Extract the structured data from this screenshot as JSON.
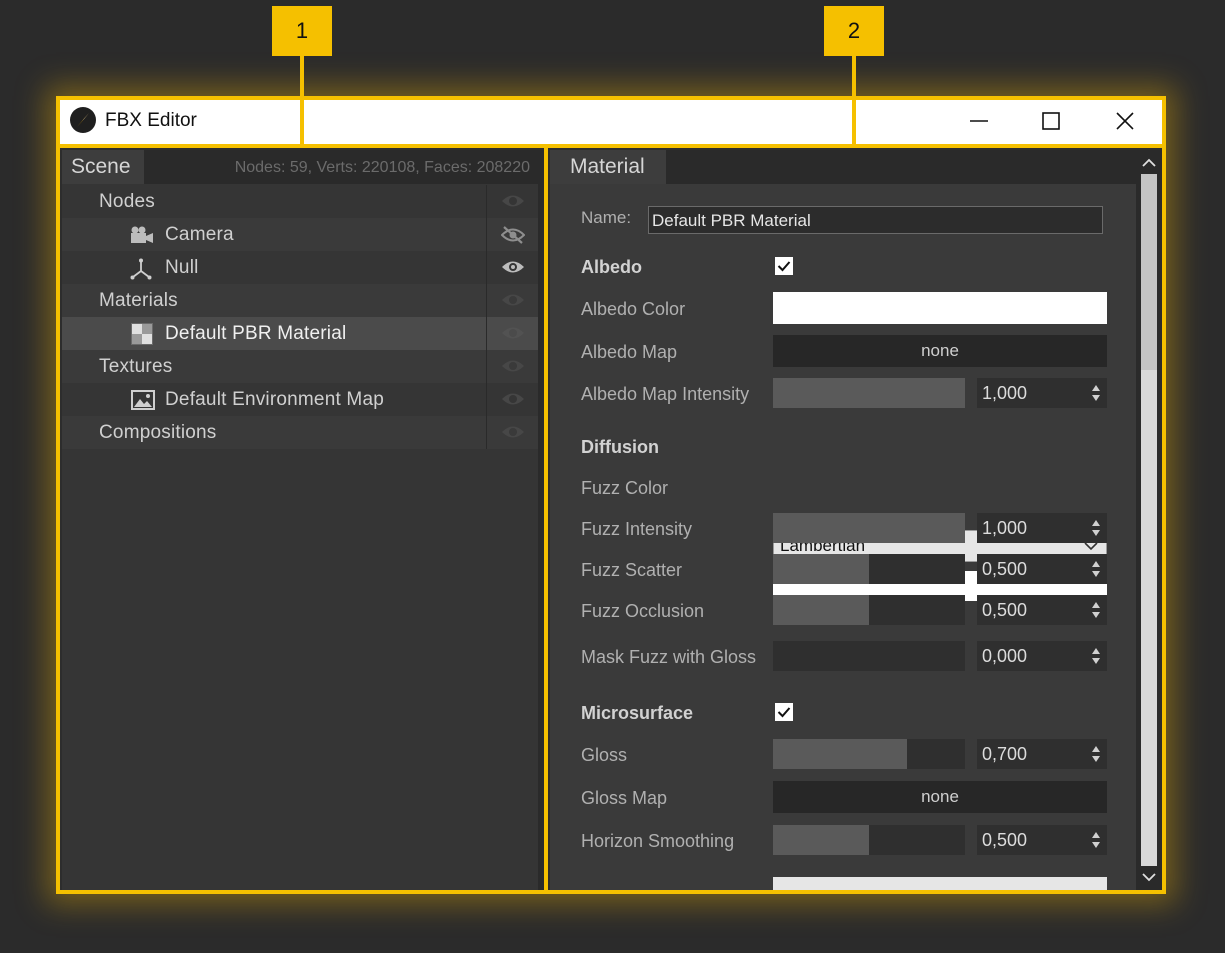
{
  "window": {
    "title": "FBX Editor"
  },
  "callouts": [
    {
      "number": "1"
    },
    {
      "number": "2"
    }
  ],
  "scene": {
    "tab_label": "Scene",
    "stats": "Nodes: 59,  Verts: 220108, Faces: 208220",
    "tree": [
      {
        "label": "Nodes",
        "icon": "folder-expander",
        "visibility": "eye-dim"
      },
      {
        "label": "Camera",
        "icon": "camera-icon",
        "visibility": "eye-hidden"
      },
      {
        "label": "Null",
        "icon": "null-axes-icon",
        "visibility": "eye-visible"
      },
      {
        "label": "Materials",
        "icon": "folder-expander",
        "visibility": "eye-dim"
      },
      {
        "label": "Default PBR Material",
        "icon": "material-checker-icon",
        "visibility": "eye-dim",
        "selected": true
      },
      {
        "label": "Textures",
        "icon": "folder-expander",
        "visibility": "eye-dim"
      },
      {
        "label": "Default Environment Map",
        "icon": "image-icon",
        "visibility": "eye-dim"
      },
      {
        "label": "Compositions",
        "icon": "none",
        "visibility": "eye-dim"
      }
    ]
  },
  "material": {
    "tab_label": "Material",
    "name_label": "Name:",
    "name_value": "Default PBR Material",
    "albedo": {
      "section": "Albedo",
      "enabled": true,
      "color_label": "Albedo Color",
      "color": "#ffffff",
      "map_label": "Albedo Map",
      "map_value": "none",
      "intensity_label": "Albedo Map Intensity",
      "intensity": "1,000",
      "intensity_fill": 1.0
    },
    "diffusion": {
      "section": "Diffusion",
      "model": "Lambertian",
      "fuzz_color_label": "Fuzz Color",
      "fuzz_color": "#ffffff",
      "fuzz_intensity_label": "Fuzz Intensity",
      "fuzz_intensity": "1,000",
      "fuzz_intensity_fill": 1.0,
      "fuzz_scatter_label": "Fuzz Scatter",
      "fuzz_scatter": "0,500",
      "fuzz_scatter_fill": 0.5,
      "fuzz_occlusion_label": "Fuzz Occlusion",
      "fuzz_occlusion": "0,500",
      "fuzz_occlusion_fill": 0.5,
      "mask_fuzz_label": "Mask Fuzz with Gloss",
      "mask_fuzz": "0,000",
      "mask_fuzz_fill": 0.0
    },
    "microsurface": {
      "section": "Microsurface",
      "enabled": true,
      "gloss_label": "Gloss",
      "gloss": "0,700",
      "gloss_fill": 0.7,
      "gloss_map_label": "Gloss Map",
      "gloss_map_value": "none",
      "horizon_label": "Horizon Smoothing",
      "horizon": "0,500",
      "horizon_fill": 0.5
    }
  },
  "colors": {
    "accent": "#f5c000",
    "panel": "#353535",
    "titlebar": "#ffffff"
  }
}
